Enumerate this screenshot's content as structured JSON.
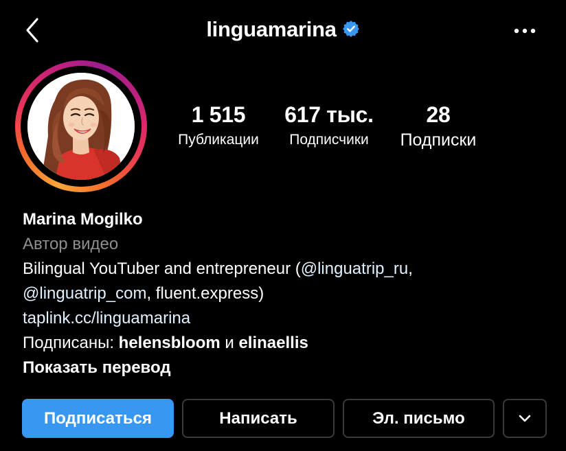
{
  "header": {
    "username": "linguamarina",
    "verified": true,
    "back_icon": "chevron-left-icon",
    "more_icon": "more-horizontal-icon"
  },
  "stats": {
    "posts": {
      "value": "1 515",
      "label": "Публикации"
    },
    "followers": {
      "value": "617 тыс.",
      "label": "Подписчики"
    },
    "following": {
      "value": "28",
      "label": "Подписки"
    }
  },
  "bio": {
    "name": "Marina Mogilko",
    "category": "Автор видео",
    "line1_text": "Bilingual YouTuber and entrepreneur (",
    "line1_mention": "@linguatrip_ru",
    "line1_end": ",",
    "line2_mention": "@linguatrip_com",
    "line2_text": ", fluent.express)",
    "link": "taplink.cc/linguamarina",
    "followed_by_prefix": "Подписаны: ",
    "followed_by_user1": "helensbloom",
    "followed_by_and": " и ",
    "followed_by_user2": "elinaellis",
    "translate": "Показать перевод"
  },
  "actions": {
    "follow": "Подписаться",
    "message": "Написать",
    "email": "Эл. письмо",
    "more_icon": "chevron-down-icon"
  },
  "colors": {
    "background": "#000000",
    "primary_button": "#3897f0",
    "verified_badge": "#3897f0",
    "muted_text": "#8e8e8e",
    "link_text": "#e0f1ff"
  }
}
